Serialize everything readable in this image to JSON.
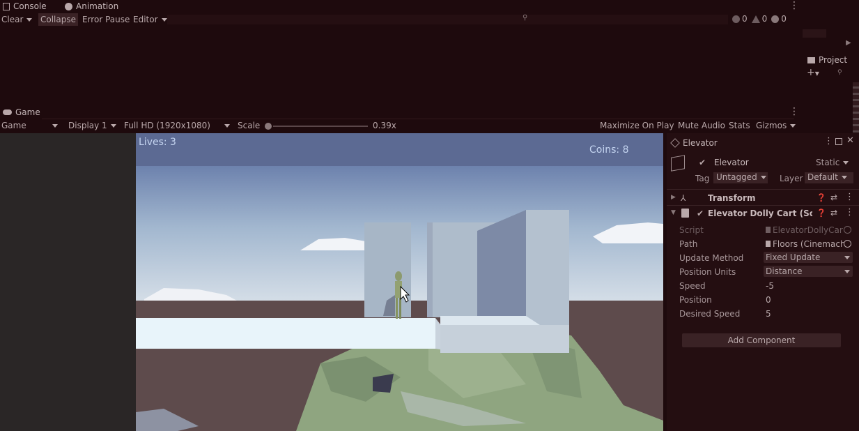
{
  "console": {
    "tab_label": "Console",
    "animation_tab_label": "Animation",
    "toolbar": {
      "clear": "Clear",
      "collapse": "Collapse",
      "error_pause": "Error Pause",
      "editor": "Editor"
    },
    "counts": {
      "info": "0",
      "warning": "0",
      "error": "0"
    }
  },
  "project": {
    "tab_label": "Project"
  },
  "game": {
    "tab_label": "Game",
    "toolbar": {
      "mode": "Game",
      "display": "Display 1",
      "resolution": "Full HD (1920x1080)",
      "scale_label": "Scale",
      "scale_value": "0.39x",
      "maximize": "Maximize On Play",
      "mute": "Mute Audio",
      "stats": "Stats",
      "gizmos": "Gizmos"
    },
    "hud": {
      "lives": "Lives: 3",
      "coins": "Coins: 8"
    }
  },
  "inspector": {
    "tab_label": "Elevator",
    "object_name": "Elevator",
    "static_label": "Static",
    "tag_label": "Tag",
    "tag_value": "Untagged",
    "layer_label": "Layer",
    "layer_value": "Default",
    "components": {
      "transform": "Transform",
      "dolly": "Elevator Dolly Cart (Script)"
    },
    "properties": {
      "script_label": "Script",
      "script_value": "ElevatorDollyCar",
      "path_label": "Path",
      "path_value": "Floors (Cinemach",
      "update_label": "Update Method",
      "update_value": "Fixed Update",
      "units_label": "Position Units",
      "units_value": "Distance",
      "speed_label": "Speed",
      "speed_value": "-5",
      "position_label": "Position",
      "position_value": "0",
      "desired_label": "Desired Speed",
      "desired_value": "5"
    },
    "add_component": "Add Component"
  },
  "colors": {
    "background": "#1e0a0d",
    "panel": "#240e11",
    "field": "#3a2225",
    "sky": "#6e83ae",
    "hud_text": "#c4d4f0"
  }
}
